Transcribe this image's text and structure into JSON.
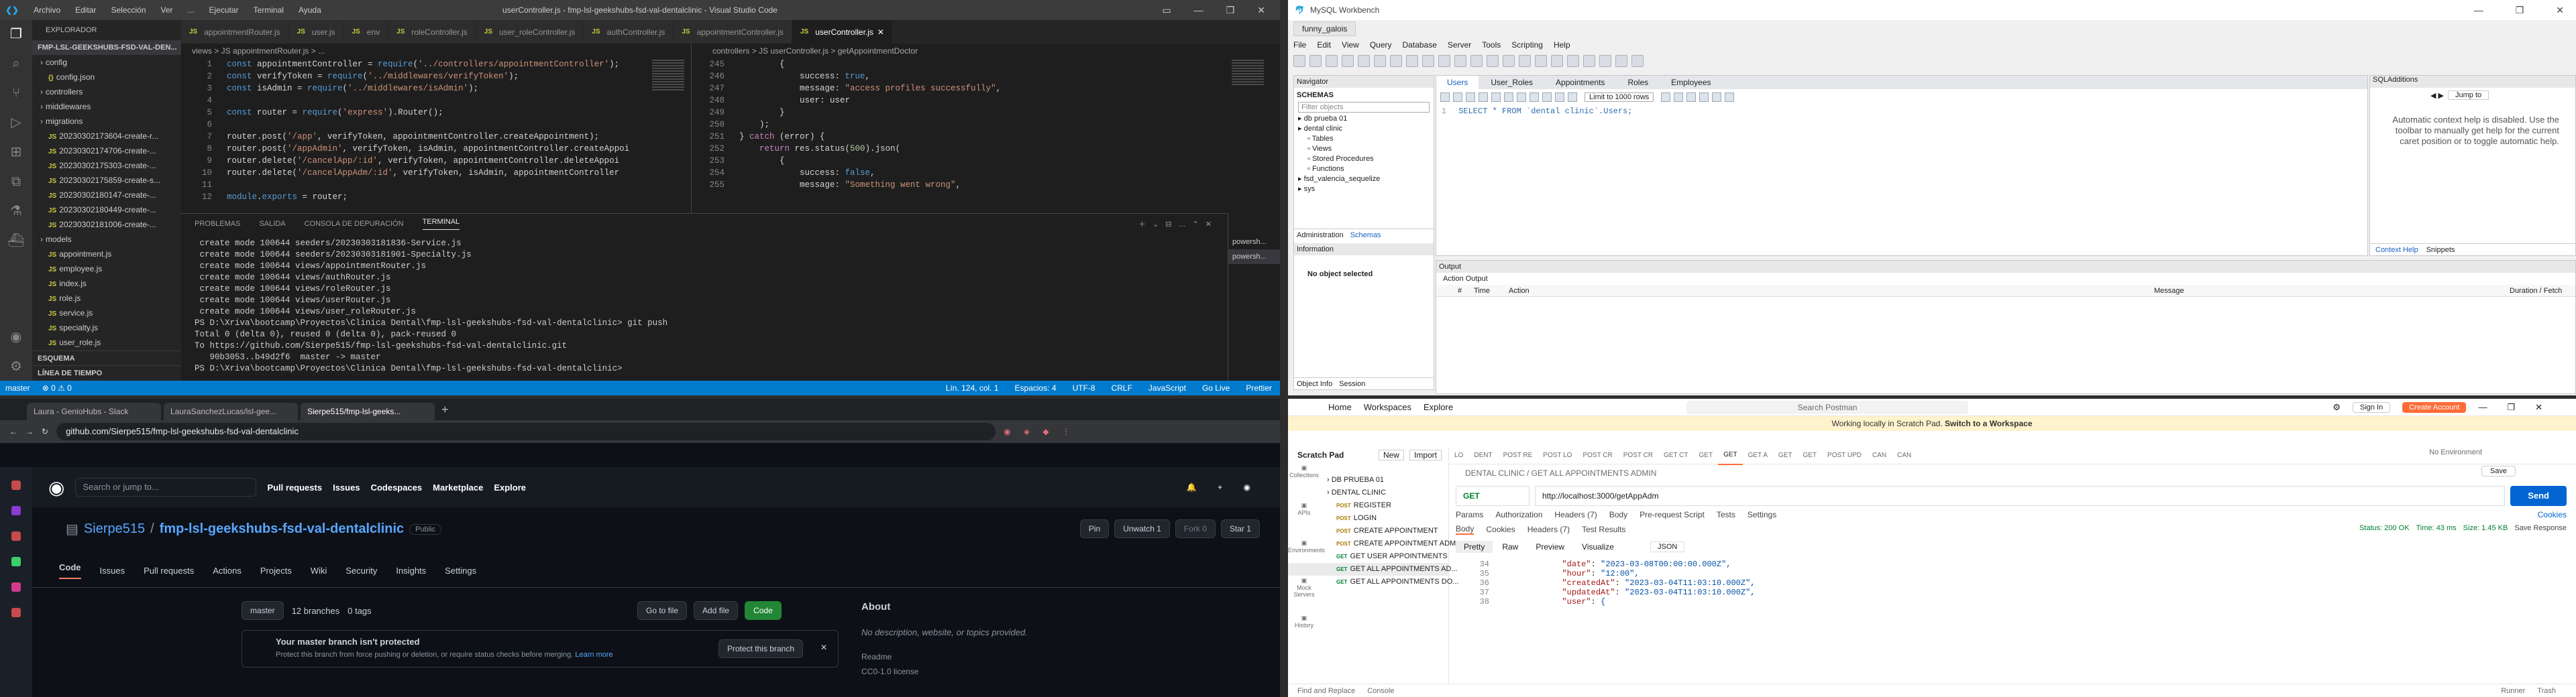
{
  "vscode": {
    "menu": [
      "Archivo",
      "Editar",
      "Selección",
      "Ver",
      "...",
      "Ejecutar",
      "Terminal",
      "Ayuda"
    ],
    "title": "userController.js - fmp-lsl-geekshubs-fsd-val-dentalclinic - Visual Studio Code",
    "explorer_label": "EXPLORADOR",
    "folder": "FMP-LSL-GEEKSHUBS-FSD-VAL-DEN...",
    "tree": [
      {
        "t": "config",
        "k": "dir",
        "d": 1
      },
      {
        "t": "config.json",
        "k": "file",
        "d": 2
      },
      {
        "t": "controllers",
        "k": "dir",
        "d": 1
      },
      {
        "t": "middlewares",
        "k": "dir",
        "d": 1
      },
      {
        "t": "migrations",
        "k": "dir",
        "d": 1
      },
      {
        "t": "20230302173604-create-r...",
        "k": "js",
        "d": 2
      },
      {
        "t": "20230302174706-create-...",
        "k": "js",
        "d": 2
      },
      {
        "t": "20230302175303-create-...",
        "k": "js",
        "d": 2
      },
      {
        "t": "20230302175859-create-s...",
        "k": "js",
        "d": 2
      },
      {
        "t": "20230302180147-create-...",
        "k": "js",
        "d": 2
      },
      {
        "t": "20230302180449-create-...",
        "k": "js",
        "d": 2
      },
      {
        "t": "20230302181006-create-...",
        "k": "js",
        "d": 2
      },
      {
        "t": "models",
        "k": "dir",
        "d": 1
      },
      {
        "t": "appointment.js",
        "k": "js",
        "d": 2
      },
      {
        "t": "employee.js",
        "k": "js",
        "d": 2
      },
      {
        "t": "index.js",
        "k": "js",
        "d": 2
      },
      {
        "t": "role.js",
        "k": "js",
        "d": 2
      },
      {
        "t": "service.js",
        "k": "js",
        "d": 2
      },
      {
        "t": "specialty.js",
        "k": "js",
        "d": 2
      },
      {
        "t": "user_role.js",
        "k": "js",
        "d": 2
      }
    ],
    "outline": "ESQUEMA",
    "timeline": "LÍNEA DE TIEMPO",
    "tabs": [
      "appointmentRouter.js",
      "user.js",
      "env",
      "roleController.js",
      "user_roleController.js",
      "authController.js",
      "appointmentController.js",
      "userController.js"
    ],
    "breadcrumb_left": "views > JS appointmentRouter.js > ...",
    "breadcrumb_right": "controllers > JS userController.js > getAppointmentDoctor",
    "left_code": [
      {
        "n": "1",
        "s": "const appointmentController = require('../controllers/appointmentController');"
      },
      {
        "n": "2",
        "s": "const verifyToken = require('../middlewares/verifyToken');"
      },
      {
        "n": "3",
        "s": "const isAdmin = require('../middlewares/isAdmin');"
      },
      {
        "n": "4",
        "s": ""
      },
      {
        "n": "5",
        "s": "const router = require('express').Router();"
      },
      {
        "n": "6",
        "s": ""
      },
      {
        "n": "7",
        "s": "router.post('/app', verifyToken, appointmentController.createAppointment);"
      },
      {
        "n": "8",
        "s": "router.post('/appAdmin', verifyToken, isAdmin, appointmentController.createAppoi"
      },
      {
        "n": "9",
        "s": "router.delete('/cancelApp/:id', verifyToken, appointmentController.deleteAppoi"
      },
      {
        "n": "10",
        "s": "router.delete('/cancelAppAdm/:id', verifyToken, isAdmin, appointmentController"
      },
      {
        "n": "11",
        "s": ""
      },
      {
        "n": "12",
        "s": "module.exports = router;"
      }
    ],
    "right_code": [
      {
        "n": "245",
        "s": "        {"
      },
      {
        "n": "246",
        "s": "            success: true,"
      },
      {
        "n": "247",
        "s": "            message: \"access profiles successfully\","
      },
      {
        "n": "248",
        "s": "            user: user"
      },
      {
        "n": "249",
        "s": "        }"
      },
      {
        "n": "250",
        "s": "    );"
      },
      {
        "n": "251",
        "s": "} catch (error) {"
      },
      {
        "n": "252",
        "s": "    return res.status(500).json("
      },
      {
        "n": "253",
        "s": "        {"
      },
      {
        "n": "254",
        "s": "            success: false,"
      },
      {
        "n": "255",
        "s": "            message: \"Something went wrong\","
      }
    ],
    "panel_tabs": [
      "PROBLEMAS",
      "SALIDA",
      "CONSOLA DE DEPURACIÓN",
      "TERMINAL"
    ],
    "terminal": [
      " create mode 100644 seeders/20230303181836-Service.js",
      " create mode 100644 seeders/20230303181901-Specialty.js",
      " create mode 100644 views/appointmentRouter.js",
      " create mode 100644 views/authRouter.js",
      " create mode 100644 views/roleRouter.js",
      " create mode 100644 views/userRouter.js",
      " create mode 100644 views/user_roleRouter.js",
      "PS D:\\Xriva\\bootcamp\\Proyectos\\Clinica Dental\\fmp-lsl-geekshubs-fsd-val-dentalclinic> git push",
      "Total 0 (delta 0), reused 0 (delta 0), pack-reused 0",
      "To https://github.com/Sierpe515/fmp-lsl-geekshubs-fsd-val-dentalclinic.git",
      "   90b3053..b49d2f6  master -> master",
      "PS D:\\Xriva\\bootcamp\\Proyectos\\Clinica Dental\\fmp-lsl-geekshubs-fsd-val-dentalclinic> "
    ],
    "term_list": [
      "powersh...",
      "powersh..."
    ],
    "status_left": [
      "master",
      "⊗ 0 ⚠ 0"
    ],
    "status_right": [
      "Lín. 124, col. 1",
      "Espacios: 4",
      "UTF-8",
      "CRLF",
      "JavaScript",
      "Go Live",
      "Prettier"
    ]
  },
  "workbench": {
    "title": "MySQL Workbench",
    "conn_tab": "funny_galois",
    "menu": [
      "File",
      "Edit",
      "View",
      "Query",
      "Database",
      "Server",
      "Tools",
      "Scripting",
      "Help"
    ],
    "navigator": "Navigator",
    "schemas_label": "SCHEMAS",
    "filter": "Filter objects",
    "schemas": [
      {
        "t": "db prueba 01",
        "d": 0
      },
      {
        "t": "dental clinic",
        "d": 0
      },
      {
        "t": "Tables",
        "d": 1
      },
      {
        "t": "Views",
        "d": 1
      },
      {
        "t": "Stored Procedures",
        "d": 1
      },
      {
        "t": "Functions",
        "d": 1
      },
      {
        "t": "fsd_valencia_sequelize",
        "d": 0
      },
      {
        "t": "sys",
        "d": 0
      }
    ],
    "nav_tabs": [
      "Administration",
      "Schemas"
    ],
    "info_label": "Information",
    "no_object": "No object selected",
    "bottom_tabs": [
      "Object Info",
      "Session"
    ],
    "query_tabs": [
      "Users",
      "User_Roles",
      "Appointments",
      "Roles",
      "Employees"
    ],
    "limit": "Limit to 1000 rows",
    "query_line": "SELECT * FROM `dental clinic`.Users;",
    "query_line_no": "1",
    "jump": "Jump to",
    "sql_additions": "SQLAdditions",
    "help_text": "Automatic context help is disabled. Use the toolbar to manually get help for the current caret position or to toggle automatic help.",
    "help_tabs": [
      "Context Help",
      "Snippets"
    ],
    "output": "Output",
    "action_output": "Action Output",
    "out_cols": [
      "#",
      "Time",
      "Action",
      "Message",
      "Duration / Fetch"
    ]
  },
  "browser": {
    "tabs": [
      "Laura - GenioHubs - Slack",
      "LauraSanchezLucas/lsl-gee...",
      "Sierpe515/fmp-lsl-geeks..."
    ],
    "url": "github.com/Sierpe515/fmp-lsl-geekshubs-fsd-val-dentalclinic",
    "search": "Search or jump to...",
    "nav": [
      "Pull requests",
      "Issues",
      "Codespaces",
      "Marketplace",
      "Explore"
    ],
    "owner": "Sierpe515",
    "repo": "fmp-lsl-geekshubs-fsd-val-dentalclinic",
    "visibility": "Public",
    "pin": "Pin",
    "unwatch": "Unwatch",
    "watch_count": "1",
    "fork": "Fork",
    "fork_count": "0",
    "star": "Star",
    "star_count": "1",
    "repo_tabs": [
      "Code",
      "Issues",
      "Pull requests",
      "Actions",
      "Projects",
      "Wiki",
      "Security",
      "Insights",
      "Settings"
    ],
    "branch": "master",
    "branches": "12 branches",
    "tags": "0 tags",
    "goto": "Go to file",
    "addfile": "Add file",
    "codebtn": "Code",
    "about": "About",
    "about_desc": "No description, website, or topics provided.",
    "readme": "Readme",
    "license": "CC0-1.0 license",
    "warn_title": "Your master branch isn't protected",
    "warn_desc": "Protect this branch from force pushing or deletion, or require status checks before merging.",
    "learn": "Learn more",
    "protect": "Protect this branch"
  },
  "postman": {
    "nav": [
      "Home",
      "Workspaces",
      "Explore"
    ],
    "search": "Search Postman",
    "signin": "Sign In",
    "create": "Create Account",
    "warn": "Working locally in Scratch Pad.",
    "warn_link": "Switch to a Workspace",
    "scratch": "Scratch Pad",
    "new": "New",
    "import": "Import",
    "side_icons": [
      "Collections",
      "APIs",
      "Environments",
      "Mock Servers",
      "History"
    ],
    "items": [
      {
        "m": "",
        "t": "DB PRUEBA 01",
        "d": 0
      },
      {
        "m": "",
        "t": "DENTAL CLINIC",
        "d": 0
      },
      {
        "m": "POST",
        "t": "REGISTER",
        "d": 1
      },
      {
        "m": "POST",
        "t": "LOGIN",
        "d": 1
      },
      {
        "m": "POST",
        "t": "CREATE APPOINTMENT",
        "d": 1
      },
      {
        "m": "POST",
        "t": "CREATE APPOINTMENT ADM...",
        "d": 1
      },
      {
        "m": "GET",
        "t": "GET USER APPOINTMENTS",
        "d": 1
      },
      {
        "m": "GET",
        "t": "GET ALL APPOINTMENTS AD...",
        "d": 1
      },
      {
        "m": "GET",
        "t": "GET ALL APPOINTMENTS DO...",
        "d": 1
      }
    ],
    "req_tabs": [
      "LO",
      "DENT",
      "POST RE",
      "POST LO",
      "POST CR",
      "POST CR",
      "GET CT",
      "GET",
      "GET",
      "GET A",
      "GET",
      "GET",
      "POST UPD",
      "CAN",
      "CAN"
    ],
    "env": "No Environment",
    "crumb": "DENTAL CLINIC / GET ALL APPOINTMENTS ADMIN",
    "save": "Save",
    "method": "GET",
    "url": "http://localhost:3000/getAppAdm",
    "send": "Send",
    "params_tabs": [
      "Params",
      "Authorization",
      "Headers (7)",
      "Body",
      "Pre-request Script",
      "Tests",
      "Settings"
    ],
    "cookies": "Cookies",
    "resp_tabs": [
      "Body",
      "Cookies",
      "Headers (7)",
      "Test Results"
    ],
    "status": "Status: 200 OK",
    "time": "Time: 43 ms",
    "size": "Size: 1.45 KB",
    "save_resp": "Save Response",
    "view_tabs": [
      "Pretty",
      "Raw",
      "Preview",
      "Visualize"
    ],
    "format": "JSON",
    "json": [
      {
        "n": "34",
        "k": "\"date\"",
        "v": "\"2023-03-08T00:00:00.000Z\","
      },
      {
        "n": "35",
        "k": "\"hour\"",
        "v": "\"12:00\","
      },
      {
        "n": "36",
        "k": "\"createdAt\"",
        "v": "\"2023-03-04T11:03:10.000Z\","
      },
      {
        "n": "37",
        "k": "\"updatedAt\"",
        "v": "\"2023-03-04T11:03:10.000Z\","
      },
      {
        "n": "38",
        "k": "\"user\"",
        "v": "{"
      }
    ],
    "footer": [
      "Find and Replace",
      "Console"
    ],
    "footer_right": [
      "Runner",
      "Trash"
    ]
  }
}
